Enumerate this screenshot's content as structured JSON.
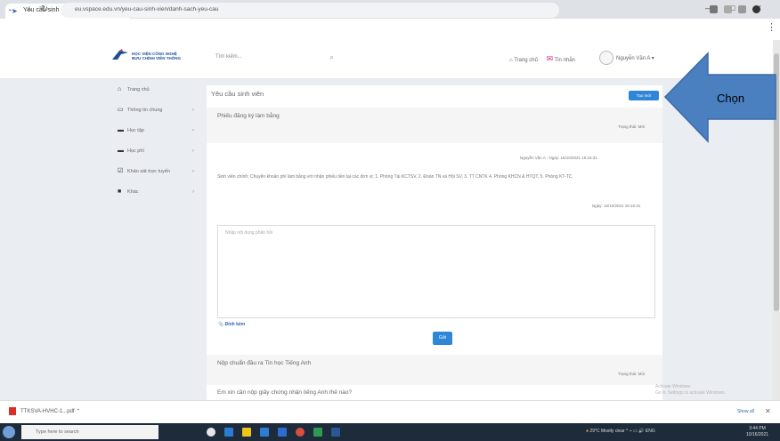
{
  "browser": {
    "tab_title": "Yêu cầu sinh viên",
    "url": "eu.vspace.edu.vn/yeu-cau-sinh-vien/danh-sach-yeu-cau"
  },
  "header": {
    "logo_line1": "HỌC VIỆN CÔNG NGHỆ",
    "logo_line2": "BƯU CHÍNH VIỄN THÔNG",
    "search_placeholder": "Tìm kiếm...",
    "nav_text": "Trang chủ",
    "notify_text": "Tin nhắn",
    "user_name": "Nguyễn Văn A"
  },
  "sidebar": {
    "items": [
      {
        "label": "Trang chủ",
        "icon": "home-icon"
      },
      {
        "label": "Thông tin chung",
        "icon": "card-icon"
      },
      {
        "label": "Học tập",
        "icon": "book-icon"
      },
      {
        "label": "Học phí",
        "icon": "money-icon"
      },
      {
        "label": "Khảo sát trực tuyến",
        "icon": "check-icon"
      },
      {
        "label": "Khác",
        "icon": "folder-icon"
      }
    ]
  },
  "main": {
    "title": "Yêu cầu sinh viên",
    "create_button": "Tạo mới",
    "request1": {
      "title": "Phiếu đăng ký làm bằng",
      "status": "Trạng thái: Mới",
      "author_line": "Nguyễn Văn A - Ngày: 16/10/2021 15:16:31",
      "body": "Sinh viên chính: Chuyển khoản phí làm bằng với nhận phiếu tiền tại các đơn vị: 1. Phòng Tài KCTSV, 2. Đoàn TN và Hội SV, 3. TT CNTK 4. Phòng KHCN & HTQT, 5. Phòng KT-TC",
      "reply_date": "Ngày: 16/10/2021 15:16:31",
      "reply_placeholder": "Nhập nội dung phản hồi",
      "attach": "Đính kèm",
      "send_button": "Gửi"
    },
    "request2": {
      "title": "Nộp chuẩn đầu ra Tin học Tiếng Anh",
      "status": "Trạng thái: Mới",
      "body": "Em xin cần nộp giấy chứng nhận tiếng Anh thế nào?"
    },
    "watermark_line1": "Activate Windows",
    "watermark_line2": "Go to Settings to activate Windows."
  },
  "downloads": {
    "file": "TTKSVA-HVHC-1...pdf",
    "show_all": "Show all"
  },
  "taskbar": {
    "search": "Type here to search",
    "tray": "29°C  Mostly clear",
    "time": "3:44 PM",
    "date": "10/16/2021"
  },
  "callout": {
    "label": "Chọn"
  }
}
